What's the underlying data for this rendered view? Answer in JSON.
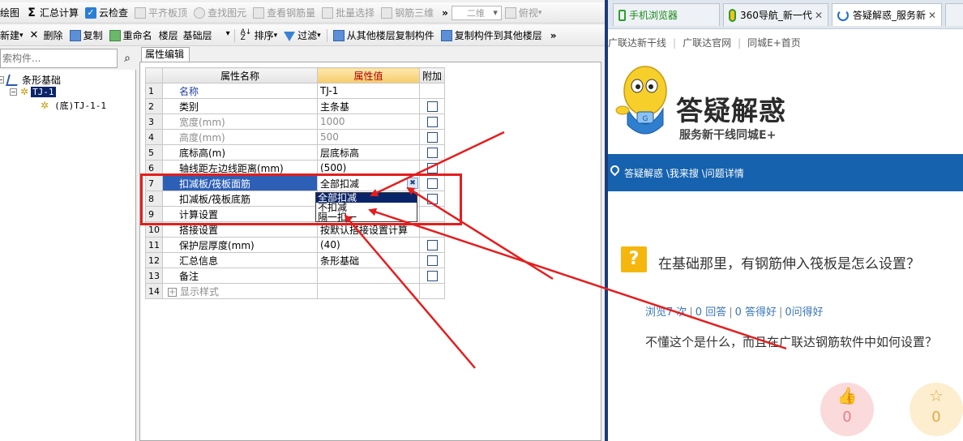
{
  "app": {
    "toolbar1": {
      "items": [
        "绘图",
        "汇总计算",
        "云检查",
        "平齐板顶",
        "查找图元",
        "查看钢筋量",
        "批量选择",
        "钢筋三维"
      ],
      "view_dropdown": "二维",
      "view_mode": "俯视",
      "more": "»"
    },
    "toolbar2": {
      "new": "新建",
      "delete": "删除",
      "copy": "复制",
      "rename": "重命名",
      "floor_label": "楼层",
      "floor_value": "基础层",
      "sort": "排序",
      "filter": "过滤",
      "copy_from_other": "从其他楼层复制构件",
      "copy_to_other": "复制构件到其他楼层",
      "more": "»"
    },
    "search": {
      "placeholder": "索构件..."
    },
    "tree": {
      "root": "条形基础",
      "child": "TJ-1",
      "grandchild": "(底)TJ-1-1"
    },
    "panel_tab": "属性编辑",
    "grid": {
      "headers": {
        "name": "属性名称",
        "value": "属性值",
        "extra": "附加"
      },
      "rows": [
        {
          "num": "1",
          "name": "名称",
          "value": "TJ-1"
        },
        {
          "num": "2",
          "name": "类别",
          "value": "主条基"
        },
        {
          "num": "3",
          "name": "宽度(mm)",
          "value": "1000"
        },
        {
          "num": "4",
          "name": "高度(mm)",
          "value": "500"
        },
        {
          "num": "5",
          "name": "底标高(m)",
          "value": "层底标高"
        },
        {
          "num": "6",
          "name": "轴线距左边线距离(mm)",
          "value": "(500)"
        },
        {
          "num": "7",
          "name": "扣减板/筏板面筋",
          "value": "全部扣减"
        },
        {
          "num": "8",
          "name": "扣减板/筏板底筋",
          "value": ""
        },
        {
          "num": "9",
          "name": "计算设置",
          "value": ""
        },
        {
          "num": "10",
          "name": "搭接设置",
          "value": "按默认搭接设置计算"
        },
        {
          "num": "11",
          "name": "保护层厚度(mm)",
          "value": "(40)"
        },
        {
          "num": "12",
          "name": "汇总信息",
          "value": "条形基础"
        },
        {
          "num": "13",
          "name": "备注",
          "value": ""
        },
        {
          "num": "14",
          "name": "显示样式",
          "value": ""
        }
      ]
    },
    "dropdown_options": [
      "全部扣减",
      "不扣减",
      "隔一扣一"
    ]
  },
  "browser": {
    "tabs": [
      "手机浏览器",
      "360导航_新一代",
      "答疑解惑_服务新"
    ],
    "links": [
      "广联达新干线",
      "广联达官网",
      "同城E+首页"
    ],
    "logo_title": "答疑解惑",
    "logo_subtitle": "服务新干线同城E+",
    "breadcrumb": "答疑解惑 \\我来搜 \\问题详情",
    "question_badge": "?",
    "question_title": "在基础那里，有钢筋伸入筏板是怎么设置？",
    "stats": [
      "浏览7 次",
      "0 回答",
      "0 答得好",
      "0问得好"
    ],
    "question_body": "不懂这个是什么，而且在广联达钢筋软件中如何设置？",
    "like_count": "0",
    "fav_count": "0"
  },
  "colors": {
    "annotation_red": "#e41e1e",
    "selection_blue": "#2d5fb6",
    "breadcrumb_bar": "#1662ae"
  }
}
